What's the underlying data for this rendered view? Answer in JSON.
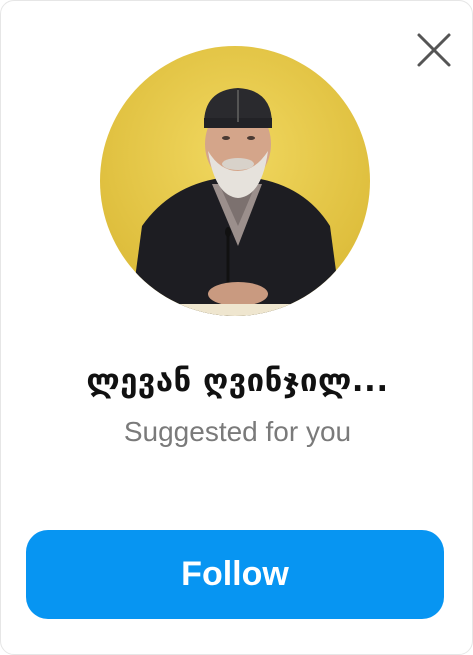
{
  "card": {
    "name": "ლევან ღვინჯილ...",
    "subtitle": "Suggested for you",
    "follow_label": "Follow",
    "close_icon": "close-icon",
    "avatar_icon": "profile-photo"
  },
  "colors": {
    "accent": "#0795f2",
    "subtitle": "#7a7a7a",
    "name": "#111111",
    "avatar_background": "#e8c640"
  }
}
